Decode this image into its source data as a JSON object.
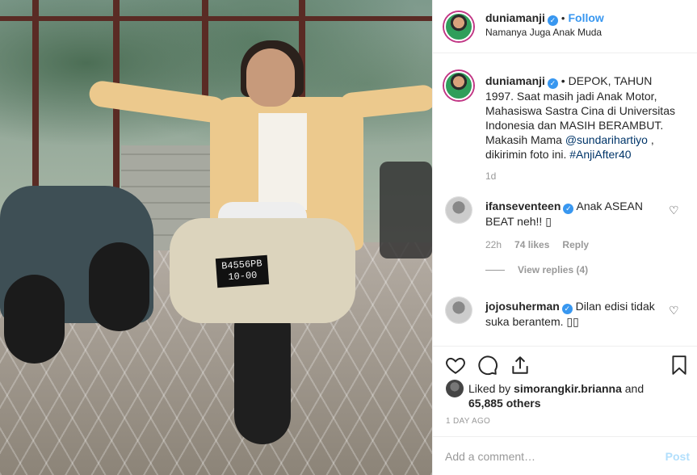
{
  "post": {
    "photo_plate_text_line1": "B4556PB",
    "photo_plate_text_line2": "10-00"
  },
  "header": {
    "username": "duniamanji",
    "dot": "•",
    "follow_label": "Follow",
    "location": "Namanya Juga Anak Muda"
  },
  "caption": {
    "username": "duniamanji",
    "text_part1": " • DEPOK, TAHUN 1997. Saat masih jadi Anak Motor, Mahasiswa Sastra Cina di Universitas Indonesia dan MASIH BERAMBUT. Makasih Mama ",
    "mention": "@sundarihartiyo",
    "text_part2": " , dikirimin foto ini. ",
    "hashtag": "#AnjiAfter40",
    "time": "1d"
  },
  "comments": [
    {
      "username": "ifanseventeen",
      "text": " Anak ASEAN BEAT neh!! ▯",
      "time": "22h",
      "likes": "74 likes",
      "reply_label": "Reply",
      "view_replies": "View replies (4)"
    },
    {
      "username": "jojosuherman",
      "text": " Dilan edisi tidak suka berantem. ▯▯"
    }
  ],
  "likes": {
    "prefix": "Liked by ",
    "liker": "simorangkir.brianna",
    "middle": " and",
    "count": "65,885 others"
  },
  "time_ago": "1 DAY AGO",
  "add_comment": {
    "placeholder": "Add a comment…",
    "post_label": "Post"
  },
  "icons": [
    "heart-icon",
    "comment-icon",
    "share-icon",
    "bookmark-icon",
    "verified-icon"
  ],
  "colors": {
    "link": "#3897f0",
    "mention": "#003569",
    "muted": "#999999",
    "post_disabled": "#b2dffc"
  }
}
